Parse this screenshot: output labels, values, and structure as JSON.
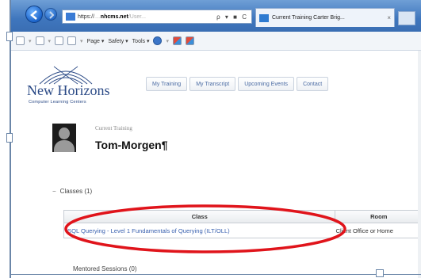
{
  "browser": {
    "address_url_prefix": "https://",
    "address_url_domain": "nhcms.net",
    "address_url_suffix": "/User...",
    "address_tools": "ρ ▾ ■ C",
    "tab_title": "Current Training Carter Brig...",
    "tab_close": "×"
  },
  "command_bar": {
    "items": [
      "Page ▾",
      "Safety ▾",
      "Tools ▾"
    ]
  },
  "site": {
    "logo_text": "New Horizons",
    "logo_sub": "Computer Learning Centers",
    "nav": [
      "My Training",
      "My Transcript",
      "Upcoming Events",
      "Contact"
    ]
  },
  "user": {
    "context_label": "Current Training",
    "name": "Tom-Morgen¶"
  },
  "classes": {
    "toggle": "−",
    "title": "Classes (1)",
    "columns": [
      "Class",
      "Room"
    ],
    "rows": [
      {
        "class": "SQL Querying - Level 1 Fundamentals of Querying (ILT/OLL)",
        "room": "Client Office or Home"
      }
    ]
  },
  "next_section": "Mentored Sessions (0)",
  "colors": {
    "highlight_ring": "#e0141b",
    "link": "#3b62b0",
    "brand": "#2b4a86"
  }
}
